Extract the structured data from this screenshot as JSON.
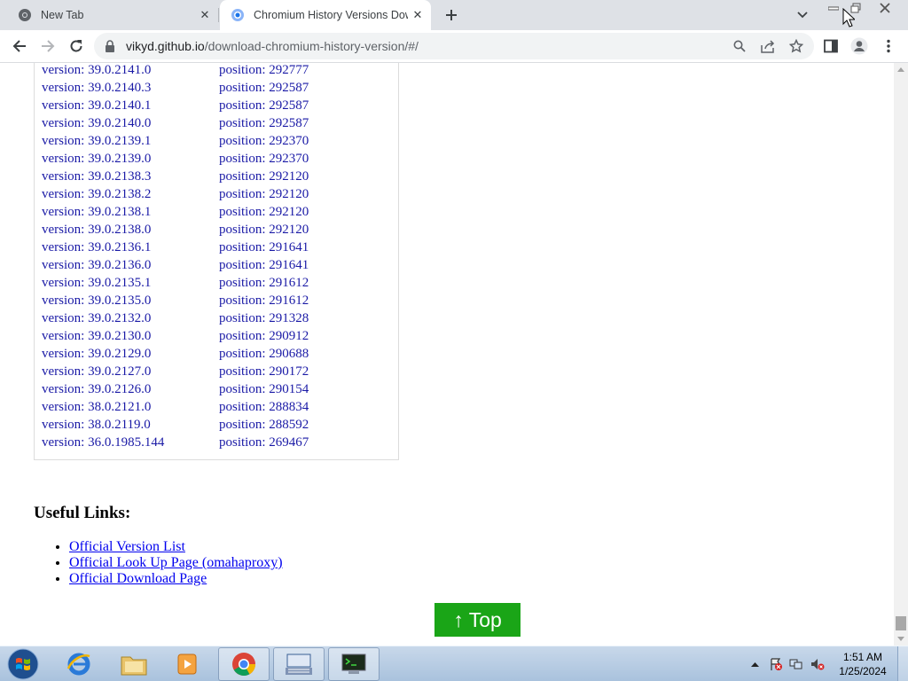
{
  "tabs": [
    {
      "title": "New Tab",
      "active": false
    },
    {
      "title": "Chromium History Versions Dow",
      "active": true
    }
  ],
  "toolbar": {
    "url_host": "vikyd.github.io",
    "url_path": "/download-chromium-history-version/#/"
  },
  "versions": [
    {
      "version": "version: 39.0.2141.0",
      "position": "position: 292777"
    },
    {
      "version": "version: 39.0.2140.3",
      "position": "position: 292587"
    },
    {
      "version": "version: 39.0.2140.1",
      "position": "position: 292587"
    },
    {
      "version": "version: 39.0.2140.0",
      "position": "position: 292587"
    },
    {
      "version": "version: 39.0.2139.1",
      "position": "position: 292370"
    },
    {
      "version": "version: 39.0.2139.0",
      "position": "position: 292370"
    },
    {
      "version": "version: 39.0.2138.3",
      "position": "position: 292120"
    },
    {
      "version": "version: 39.0.2138.2",
      "position": "position: 292120"
    },
    {
      "version": "version: 39.0.2138.1",
      "position": "position: 292120"
    },
    {
      "version": "version: 39.0.2138.0",
      "position": "position: 292120"
    },
    {
      "version": "version: 39.0.2136.1",
      "position": "position: 291641"
    },
    {
      "version": "version: 39.0.2136.0",
      "position": "position: 291641"
    },
    {
      "version": "version: 39.0.2135.1",
      "position": "position: 291612"
    },
    {
      "version": "version: 39.0.2135.0",
      "position": "position: 291612"
    },
    {
      "version": "version: 39.0.2132.0",
      "position": "position: 291328"
    },
    {
      "version": "version: 39.0.2130.0",
      "position": "position: 290912"
    },
    {
      "version": "version: 39.0.2129.0",
      "position": "position: 290688"
    },
    {
      "version": "version: 39.0.2127.0",
      "position": "position: 290172"
    },
    {
      "version": "version: 39.0.2126.0",
      "position": "position: 290154"
    },
    {
      "version": "version: 38.0.2121.0",
      "position": "position: 288834"
    },
    {
      "version": "version: 38.0.2119.0",
      "position": "position: 288592"
    },
    {
      "version": "version: 36.0.1985.144",
      "position": "position: 269467"
    }
  ],
  "links": {
    "heading": "Useful Links:",
    "items": [
      "Official Version List",
      "Official Look Up Page (omahaproxy)",
      "Official Download Page"
    ]
  },
  "top_button": "↑ Top",
  "taskbar": {
    "apps": [
      "internet-explorer",
      "file-explorer",
      "media-player",
      "chrome",
      "keyboard-app",
      "terminal-app"
    ],
    "time": "1:51 AM",
    "date": "1/25/2024"
  },
  "colors": {
    "link_text": "#1a1aa6",
    "top_button_bg": "#1aa517",
    "tabstrip_bg": "#dee1e6"
  }
}
